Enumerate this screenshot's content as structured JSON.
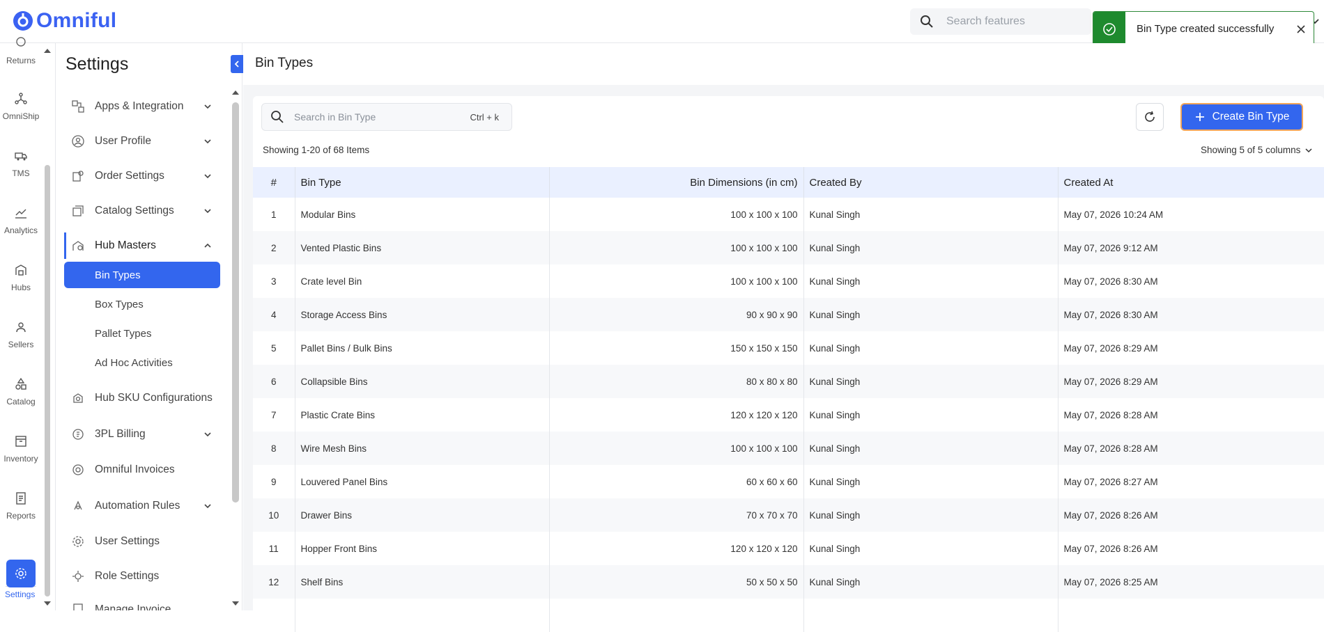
{
  "app": {
    "logo_text": "Omniful"
  },
  "topbar": {
    "search_placeholder": "Search features"
  },
  "toast": {
    "message": "Bin Type created successfully"
  },
  "rail": {
    "items": [
      {
        "label": "Returns",
        "icon": "returns-icon"
      },
      {
        "label": "OmniShip",
        "icon": "omniship-icon"
      },
      {
        "label": "TMS",
        "icon": "truck-icon"
      },
      {
        "label": "Analytics",
        "icon": "analytics-icon"
      },
      {
        "label": "Hubs",
        "icon": "warehouse-icon"
      },
      {
        "label": "Sellers",
        "icon": "user-icon"
      },
      {
        "label": "Catalog",
        "icon": "shapes-icon"
      },
      {
        "label": "Inventory",
        "icon": "archive-icon"
      },
      {
        "label": "Reports",
        "icon": "report-icon"
      },
      {
        "label": "Settings",
        "icon": "gear-icon"
      }
    ]
  },
  "settings": {
    "title": "Settings",
    "nav": [
      {
        "label": "Apps & Integration",
        "icon": "integration-icon",
        "chevron": "down"
      },
      {
        "label": "User Profile",
        "icon": "user-circle-icon",
        "chevron": "down"
      },
      {
        "label": "Order Settings",
        "icon": "order-settings-icon",
        "chevron": "down"
      },
      {
        "label": "Catalog Settings",
        "icon": "catalog-settings-icon",
        "chevron": "down"
      },
      {
        "label": "Hub Masters",
        "icon": "hub-masters-icon",
        "chevron": "up"
      }
    ],
    "sub_items": [
      "Bin Types",
      "Box Types",
      "Pallet Types",
      "Ad Hoc Activities"
    ],
    "nav_after": [
      {
        "label": "Hub SKU Configurations",
        "icon": "hub-sku-icon",
        "chevron": ""
      },
      {
        "label": "3PL Billing",
        "icon": "billing-icon",
        "chevron": "down"
      },
      {
        "label": "Omniful Invoices",
        "icon": "invoice-icon",
        "chevron": ""
      },
      {
        "label": "Automation Rules",
        "icon": "automation-icon",
        "chevron": "down"
      },
      {
        "label": "User Settings",
        "icon": "user-settings-icon",
        "chevron": ""
      },
      {
        "label": "Role Settings",
        "icon": "role-settings-icon",
        "chevron": ""
      },
      {
        "label": "Manage Invoice",
        "icon": "manage-invoice-icon",
        "chevron": ""
      }
    ]
  },
  "page": {
    "title": "Bin Types",
    "search_placeholder": "Search in Bin Type",
    "search_shortcut": "Ctrl + k",
    "showing_items": "Showing 1-20 of 68 Items",
    "create_label": "Create Bin Type",
    "showing_columns": "Showing 5 of 5 columns"
  },
  "table": {
    "headers": [
      "#",
      "Bin Type",
      "Bin Dimensions (in cm)",
      "Created By",
      "Created At"
    ],
    "rows": [
      [
        "1",
        "Modular Bins",
        "100 x 100 x 100",
        "Kunal Singh",
        "May 07, 2026 10:24 AM"
      ],
      [
        "2",
        "Vented Plastic Bins",
        "100 x 100 x 100",
        "Kunal Singh",
        "May 07, 2026 9:12 AM"
      ],
      [
        "3",
        "Crate level Bin",
        "100 x 100 x 100",
        "Kunal Singh",
        "May 07, 2026 8:30 AM"
      ],
      [
        "4",
        "Storage Access Bins",
        "90 x 90 x 90",
        "Kunal Singh",
        "May 07, 2026 8:30 AM"
      ],
      [
        "5",
        "Pallet Bins / Bulk Bins",
        "150 x 150 x 150",
        "Kunal Singh",
        "May 07, 2026 8:29 AM"
      ],
      [
        "6",
        "Collapsible Bins",
        "80 x 80 x 80",
        "Kunal Singh",
        "May 07, 2026 8:29 AM"
      ],
      [
        "7",
        "Plastic Crate Bins",
        "120 x 120 x 120",
        "Kunal Singh",
        "May 07, 2026 8:28 AM"
      ],
      [
        "8",
        "Wire Mesh Bins",
        "100 x 100 x 100",
        "Kunal Singh",
        "May 07, 2026 8:28 AM"
      ],
      [
        "9",
        "Louvered Panel Bins",
        "60 x 60 x 60",
        "Kunal Singh",
        "May 07, 2026 8:27 AM"
      ],
      [
        "10",
        "Drawer Bins",
        "70 x 70 x 70",
        "Kunal Singh",
        "May 07, 2026 8:26 AM"
      ],
      [
        "11",
        "Hopper Front Bins",
        "120 x 120 x 120",
        "Kunal Singh",
        "May 07, 2026 8:26 AM"
      ],
      [
        "12",
        "Shelf Bins",
        "50 x 50 x 50",
        "Kunal Singh",
        "May 07, 2026 8:25 AM"
      ],
      [
        "",
        "",
        "",
        "",
        ""
      ]
    ]
  },
  "colors": {
    "accent": "#3366ee",
    "success": "#1e8a2e",
    "header_bg": "#eaf0ff"
  }
}
